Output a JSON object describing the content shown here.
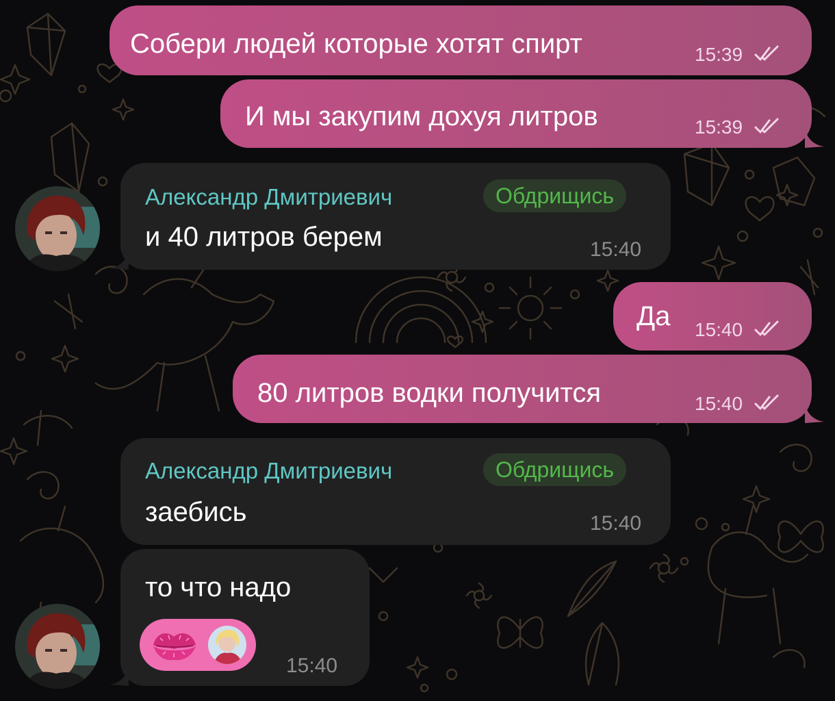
{
  "messages": [
    {
      "direction": "outgoing",
      "text": "Собери людей которые хотят спирт",
      "time": "15:39",
      "status": "read-double-check-icon"
    },
    {
      "direction": "outgoing",
      "text": "И мы закупим дохуя литров",
      "time": "15:39",
      "status": "read-double-check-icon"
    },
    {
      "direction": "incoming",
      "sender": "Александр Дмитриевич",
      "badge": "Обдрищись",
      "text": "и 40 литров берем",
      "time": "15:40"
    },
    {
      "direction": "outgoing",
      "text": "Да",
      "time": "15:40",
      "status": "read-double-check-icon"
    },
    {
      "direction": "outgoing",
      "text": "80 литров водки получится",
      "time": "15:40",
      "status": "read-double-check-icon"
    },
    {
      "direction": "incoming",
      "sender": "Александр Дмитриевич",
      "badge": "Обдрищись",
      "text": "заебись",
      "time": "15:40"
    },
    {
      "direction": "incoming",
      "text": "то что надо",
      "time": "15:40",
      "reaction": {
        "emoji": "kiss-mark-icon",
        "by": "user-avatar"
      }
    }
  ],
  "colors": {
    "outgoing_bubble": "#b0507d",
    "incoming_bubble": "#212121",
    "sender_name": "#5fc7c4",
    "badge_text": "#53b84a",
    "background": "#0b0a0c"
  }
}
